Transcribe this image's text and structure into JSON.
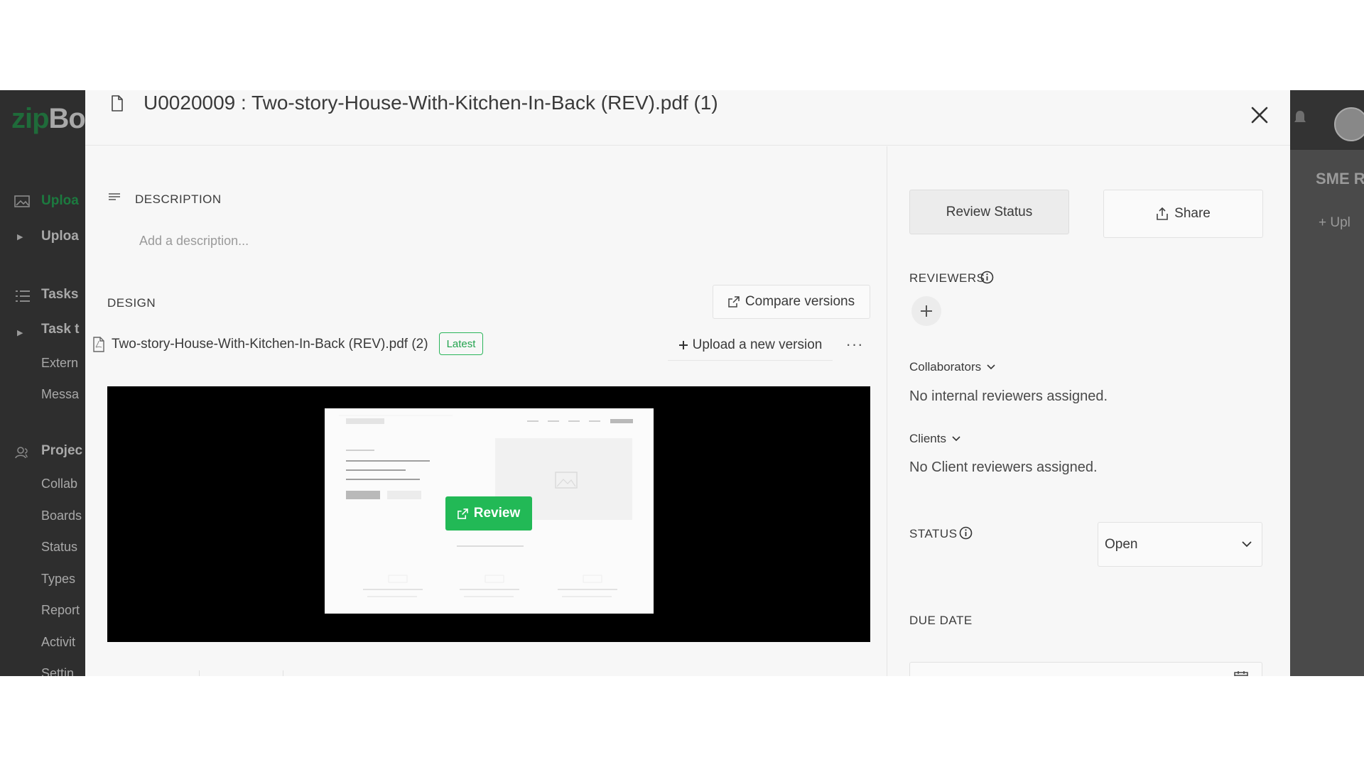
{
  "background_app": {
    "logo_zip": "zip",
    "logo_bo": "Bo",
    "sidebar_items": [
      "Uploa",
      "Uploa",
      "Tasks",
      "Task t",
      "Extern",
      "Messa",
      "Projec",
      "Collab",
      "Boards",
      "Status",
      "Types",
      "Report",
      "Activit",
      "Settin"
    ],
    "right_title": "SME R",
    "right_upload": "Upl"
  },
  "modal": {
    "title": "U0020009 : Two-story-House-With-Kitchen-In-Back (REV).pdf (1)",
    "description": {
      "label": "DESCRIPTION",
      "placeholder": "Add a description..."
    },
    "design": {
      "label": "DESIGN",
      "compare_label": "Compare versions",
      "file_name": "Two-story-House-With-Kitchen-In-Back (REV).pdf (2)",
      "badge": "Latest",
      "upload_label": "Upload a new version",
      "more_label": "···",
      "review_label": "Review"
    },
    "sidebar": {
      "review_status_label": "Review Status",
      "share_label": "Share",
      "reviewers_label": "REVIEWERS",
      "collaborators_label": "Collaborators",
      "collaborators_empty": "No internal reviewers assigned.",
      "clients_label": "Clients",
      "clients_empty": "No Client reviewers assigned.",
      "status_label": "STATUS",
      "status_value": "Open",
      "due_date_label": "DUE DATE"
    }
  },
  "colors": {
    "accent_green": "#22b956",
    "badge_green": "#22a34e",
    "overlay_dark": "#3c3c3c"
  }
}
